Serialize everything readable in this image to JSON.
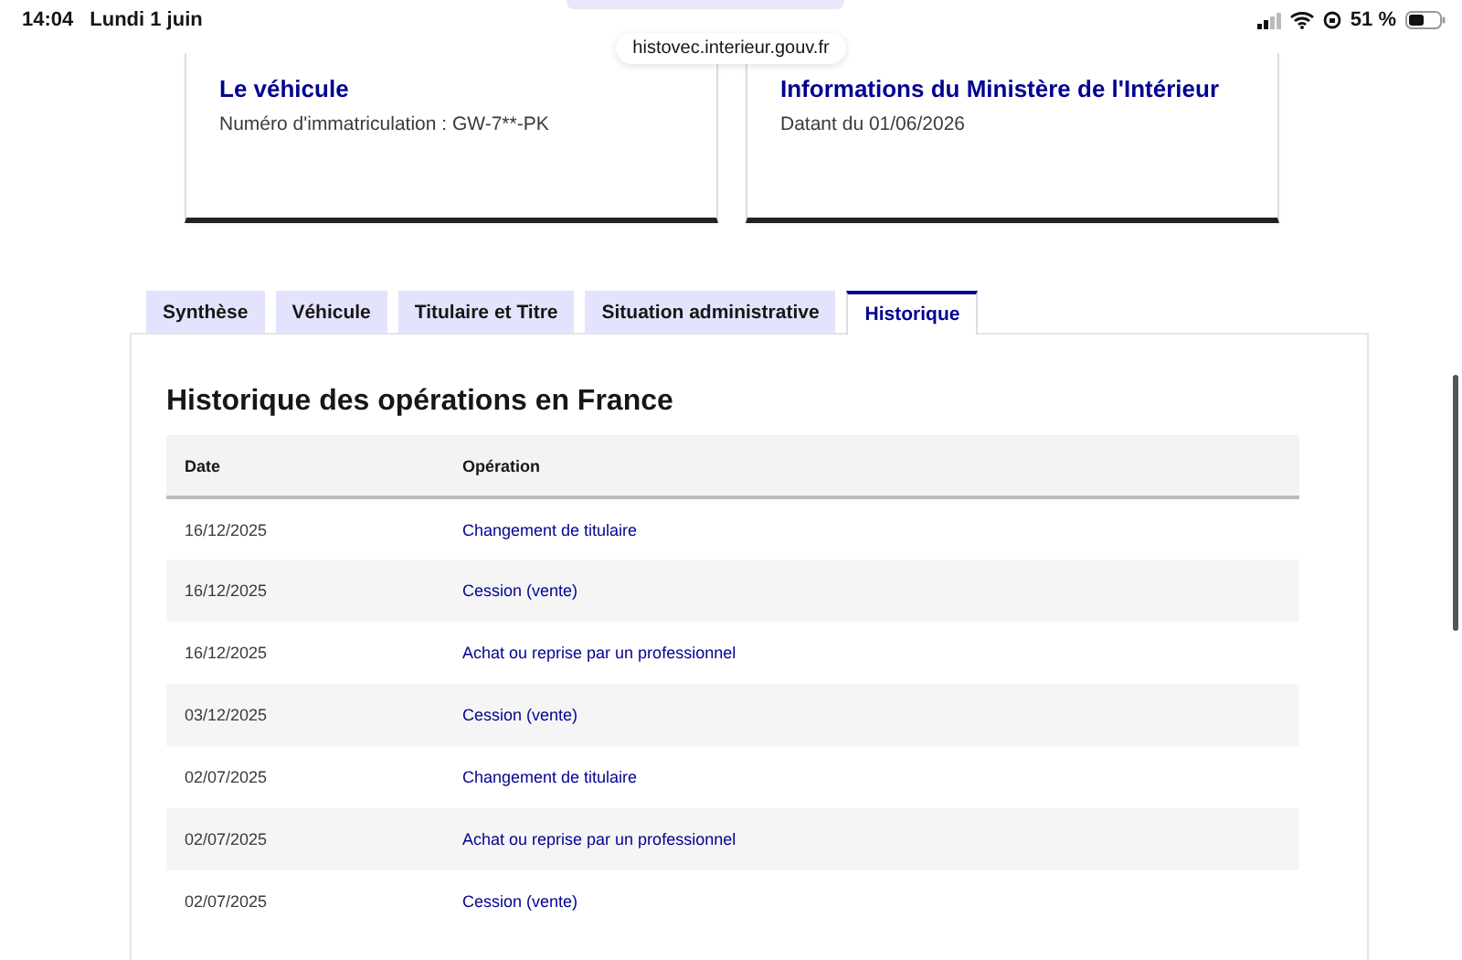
{
  "status_bar": {
    "time": "14:04",
    "date": "Lundi 1 juin",
    "battery": "51 %"
  },
  "address_bar": {
    "url": "histovec.interieur.gouv.fr"
  },
  "cards": [
    {
      "title": "Le véhicule",
      "text": "Numéro d'immatriculation : GW-7**-PK"
    },
    {
      "title": "Informations du Ministère de l'Intérieur",
      "text": "Datant du 01/06/2026"
    }
  ],
  "tabs": [
    {
      "label": "Synthèse",
      "selected": false
    },
    {
      "label": "Véhicule",
      "selected": false
    },
    {
      "label": "Titulaire et Titre",
      "selected": false
    },
    {
      "label": "Situation administrative",
      "selected": false
    },
    {
      "label": "Historique",
      "selected": true
    }
  ],
  "panel": {
    "heading": "Historique des opérations en France",
    "table": {
      "columns": [
        "Date",
        "Opération"
      ],
      "rows": [
        {
          "date": "16/12/2025",
          "operation": "Changement de titulaire"
        },
        {
          "date": "16/12/2025",
          "operation": "Cession (vente)"
        },
        {
          "date": "16/12/2025",
          "operation": "Achat ou reprise par un professionnel"
        },
        {
          "date": "03/12/2025",
          "operation": "Cession (vente)"
        },
        {
          "date": "02/07/2025",
          "operation": "Changement de titulaire"
        },
        {
          "date": "02/07/2025",
          "operation": "Achat ou reprise par un professionnel"
        },
        {
          "date": "02/07/2025",
          "operation": "Cession (vente)"
        }
      ]
    }
  }
}
